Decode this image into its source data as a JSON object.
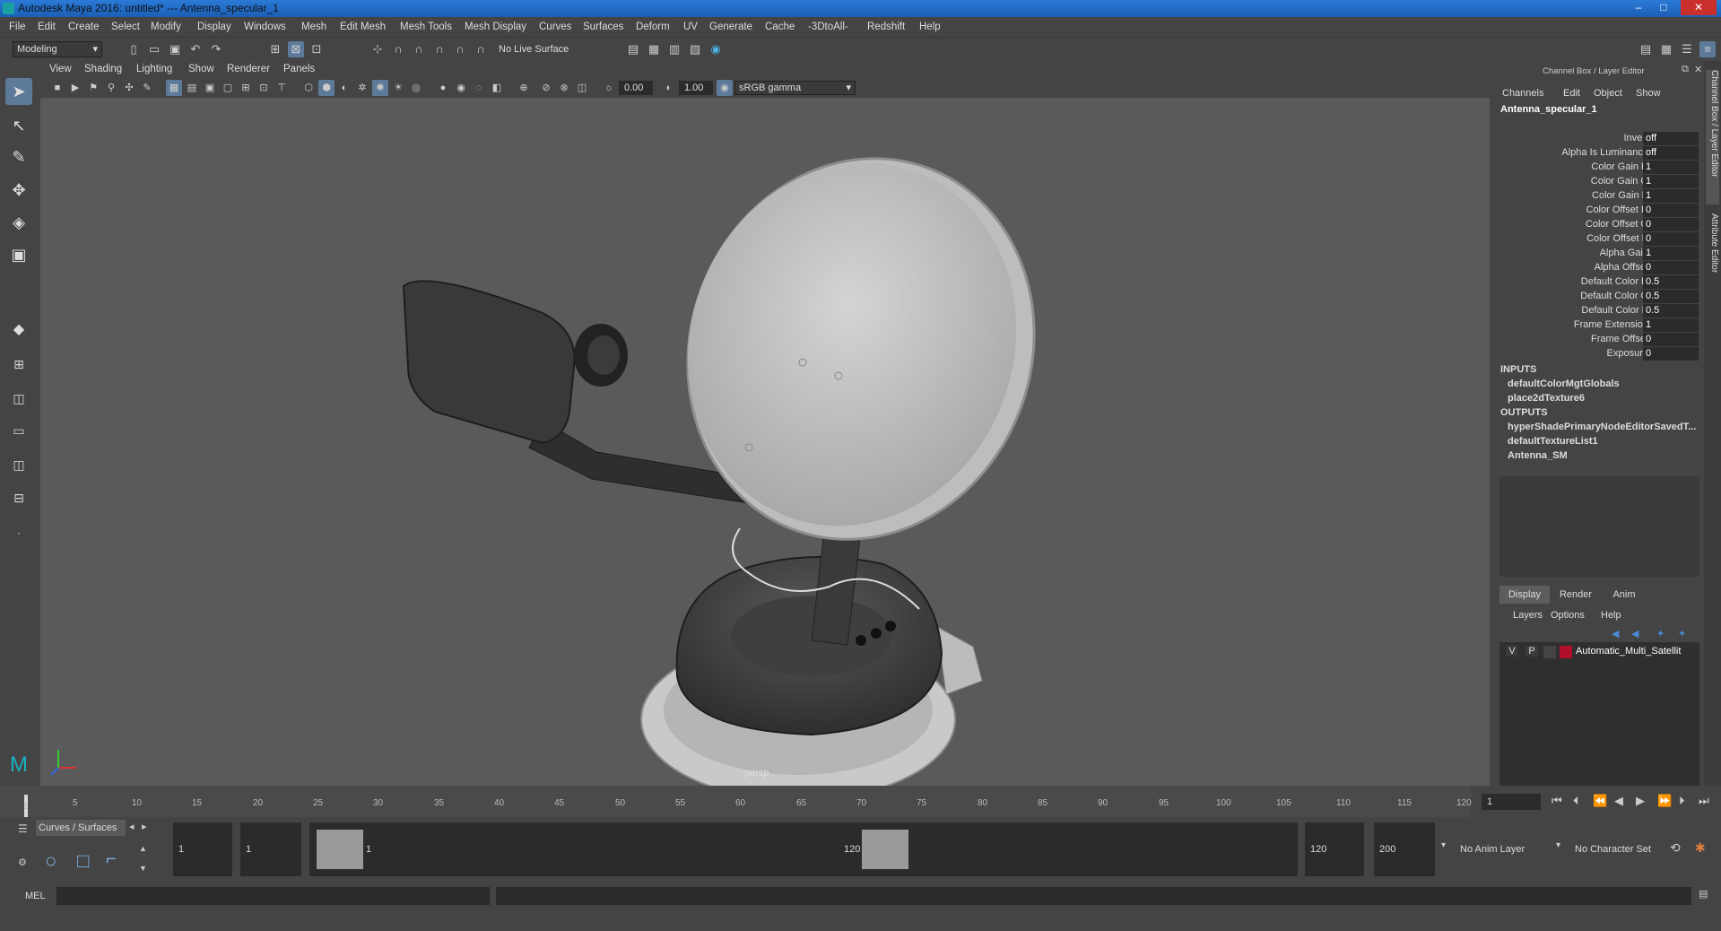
{
  "window": {
    "title": "Autodesk Maya 2016: untitled*   ---   Antenna_specular_1",
    "minimize": "‒",
    "maximize": "□",
    "close": "✕"
  },
  "menubar": [
    "File",
    "Edit",
    "Create",
    "Select",
    "Modify",
    "Display",
    "Windows",
    "Mesh",
    "Edit Mesh",
    "Mesh Tools",
    "Mesh Display",
    "Curves",
    "Surfaces",
    "Deform",
    "UV",
    "Generate",
    "Cache",
    "-3DtoAll-",
    "Redshift",
    "Help"
  ],
  "statusline": {
    "mode": "Modeling",
    "live_surface": "No Live Surface"
  },
  "viewport": {
    "menu": [
      "View",
      "Shading",
      "Lighting",
      "Show",
      "Renderer",
      "Panels"
    ],
    "exposure": "0.00",
    "gamma": "1.00",
    "color_space": "sRGB gamma",
    "camera_label": "persp"
  },
  "channel_box": {
    "header": "Channel Box / Layer Editor",
    "menu": [
      "Channels",
      "Edit",
      "Object",
      "Show"
    ],
    "node_name": "Antenna_specular_1",
    "attributes": [
      {
        "label": "Invert",
        "value": "off"
      },
      {
        "label": "Alpha Is Luminance",
        "value": "off"
      },
      {
        "label": "Color Gain R",
        "value": "1"
      },
      {
        "label": "Color Gain G",
        "value": "1"
      },
      {
        "label": "Color Gain B",
        "value": "1"
      },
      {
        "label": "Color Offset R",
        "value": "0"
      },
      {
        "label": "Color Offset G",
        "value": "0"
      },
      {
        "label": "Color Offset B",
        "value": "0"
      },
      {
        "label": "Alpha Gain",
        "value": "1"
      },
      {
        "label": "Alpha Offset",
        "value": "0"
      },
      {
        "label": "Default Color R",
        "value": "0.5"
      },
      {
        "label": "Default Color G",
        "value": "0.5"
      },
      {
        "label": "Default Color B",
        "value": "0.5"
      },
      {
        "label": "Frame Extension",
        "value": "1"
      },
      {
        "label": "Frame Offset",
        "value": "0"
      },
      {
        "label": "Exposure",
        "value": "0"
      }
    ],
    "inputs_header": "INPUTS",
    "inputs": [
      "defaultColorMgtGlobals",
      "place2dTexture6"
    ],
    "outputs_header": "OUTPUTS",
    "outputs": [
      "hyperShadePrimaryNodeEditorSavedT...",
      "defaultTextureList1",
      "Antenna_SM"
    ]
  },
  "layer_editor": {
    "tabs": [
      "Display",
      "Render",
      "Anim"
    ],
    "menu": [
      "Layers",
      "Options",
      "Help"
    ],
    "layer": {
      "v": "V",
      "p": "P",
      "name": "Automatic_Multi_Satellit",
      "color": "#b0102a"
    }
  },
  "side_tabs": [
    "Channel Box / Layer Editor",
    "Attribute Editor"
  ],
  "timeline": {
    "ticks": [
      "1",
      "5",
      "10",
      "15",
      "20",
      "25",
      "30",
      "35",
      "40",
      "45",
      "50",
      "55",
      "60",
      "65",
      "70",
      "75",
      "80",
      "85",
      "90",
      "95",
      "100",
      "105",
      "110",
      "115",
      "120"
    ],
    "current_frame": "1"
  },
  "range": {
    "shelf_tab": "Curves / Surfaces",
    "start": "1",
    "playback_start": "1",
    "slider_start": "1",
    "slider_end": "120",
    "playback_end": "120",
    "end": "200",
    "anim_layer": "No Anim Layer",
    "character_set": "No Character Set"
  },
  "cmdline": {
    "label": "MEL"
  }
}
